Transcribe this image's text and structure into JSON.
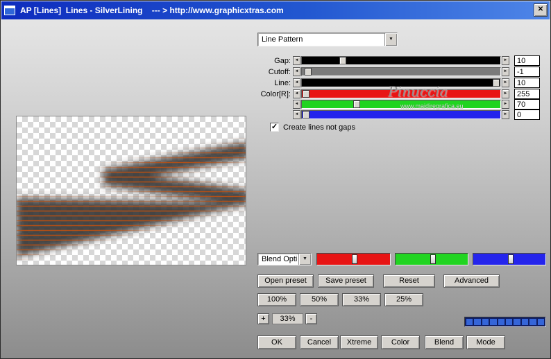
{
  "window": {
    "title": "AP [Lines]  Lines - SilverLining    --- > http://www.graphicxtras.com"
  },
  "icons": {
    "close": "✕",
    "arrow_left": "◄",
    "arrow_right": "►",
    "dropdown": "▼",
    "check": "✓"
  },
  "pattern": {
    "selected": "Line Pattern"
  },
  "sliders": [
    {
      "label": "Gap:",
      "value": "10"
    },
    {
      "label": "Cutoff:",
      "value": "-1"
    },
    {
      "label": "Line:",
      "value": "10"
    },
    {
      "label": "Color[R]:",
      "value": "255"
    },
    {
      "label": "",
      "value": "70"
    },
    {
      "label": "",
      "value": "0"
    }
  ],
  "checkbox": {
    "label": "Create lines not gaps",
    "checked": true
  },
  "watermark": {
    "name": "Pinuccia",
    "site": "www.maidiregrafica.eu"
  },
  "blend": {
    "selected": "Blend Opti"
  },
  "zoom": {
    "plus": "+",
    "minus": "-",
    "value": "33%"
  },
  "buttons": {
    "open_preset": "Open preset",
    "save_preset": "Save preset",
    "reset": "Reset",
    "advanced": "Advanced",
    "zoom_100": "100%",
    "zoom_50": "50%",
    "zoom_33": "33%",
    "zoom_25": "25%",
    "ok": "OK",
    "cancel": "Cancel",
    "xtreme": "Xtreme",
    "color": "Color",
    "blend": "Blend",
    "mode": "Mode"
  },
  "progress": {
    "total_segments": 10,
    "filled_segments": 10
  },
  "colors": {
    "titlebar_left": "#0e2cbe",
    "titlebar_right": "#4f86e8",
    "gap_track": "#000000",
    "cutoff_track": "#7b7b7b",
    "line_track": "#000000",
    "red_track": "#e81414",
    "green_track": "#21d421",
    "blue_track": "#2424ec",
    "stripe_orange": "#bf5010",
    "shape_gray": "#3a3a3a",
    "progress_segment": "#3565d8"
  }
}
